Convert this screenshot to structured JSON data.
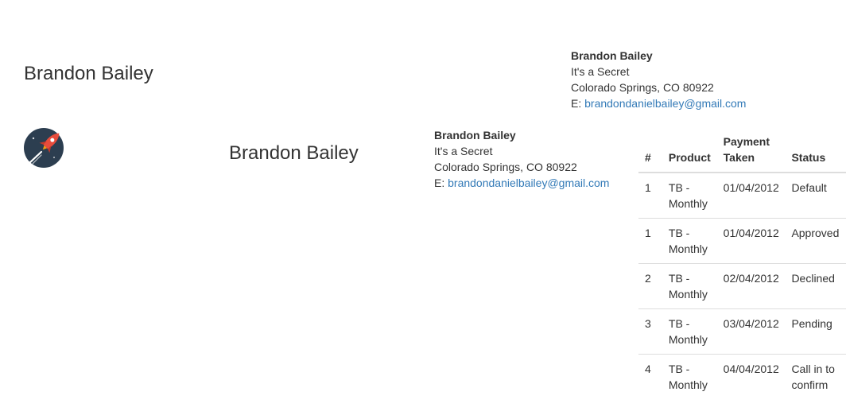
{
  "header": {
    "title": "Brandon Bailey",
    "address": {
      "name": "Brandon Bailey",
      "line1": "It's a Secret",
      "line2": "Colorado Springs, CO 80922",
      "email_prefix": "E: ",
      "email": "brandondanielbailey@gmail.com"
    }
  },
  "invoice": {
    "logo_icon": "rocket-icon",
    "title": "Brandon Bailey",
    "address": {
      "name": "Brandon Bailey",
      "line1": "It's a Secret",
      "line2": "Colorado Springs, CO 80922",
      "email_prefix": "E: ",
      "email": "brandondanielbailey@gmail.com"
    }
  },
  "table": {
    "headers": [
      "#",
      "Product",
      "Payment Taken",
      "Status"
    ],
    "rows": [
      {
        "num": "1",
        "product": "TB - Monthly",
        "date": "01/04/2012",
        "status": "Default"
      },
      {
        "num": "1",
        "product": "TB - Monthly",
        "date": "01/04/2012",
        "status": "Approved"
      },
      {
        "num": "2",
        "product": "TB - Monthly",
        "date": "02/04/2012",
        "status": "Declined"
      },
      {
        "num": "3",
        "product": "TB - Monthly",
        "date": "03/04/2012",
        "status": "Pending"
      },
      {
        "num": "4",
        "product": "TB - Monthly",
        "date": "04/04/2012",
        "status": "Call in to confirm"
      }
    ]
  },
  "colors": {
    "link": "#337ab7",
    "logo_circle": "#2c3e50",
    "rocket": "#e74c3c"
  }
}
